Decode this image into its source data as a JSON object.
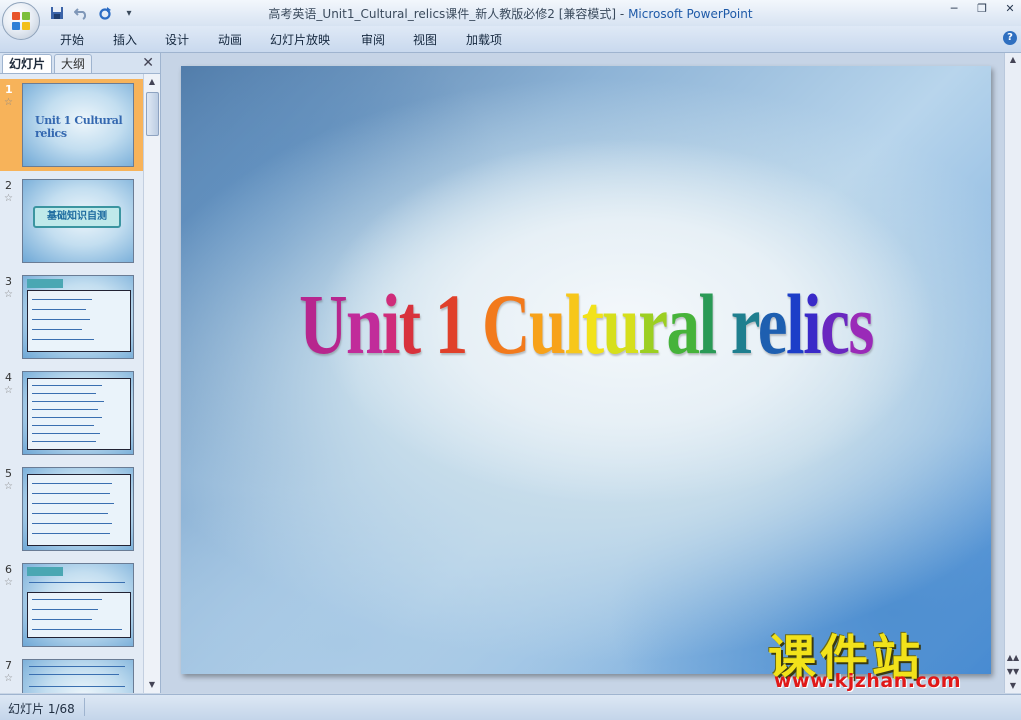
{
  "window": {
    "title_doc": "高考英语_Unit1_Cultural_relics课件_新人教版必修2 [兼容模式]",
    "title_sep": " - ",
    "title_app": "Microsoft PowerPoint"
  },
  "qat": {
    "save_icon": "save-icon",
    "undo_icon": "undo-icon",
    "redo_icon": "redo-icon",
    "more": "▾"
  },
  "ribbon": {
    "tabs": [
      "开始",
      "插入",
      "设计",
      "动画",
      "幻灯片放映",
      "审阅",
      "视图",
      "加载项"
    ],
    "help": "?"
  },
  "pane": {
    "tabs": [
      "幻灯片",
      "大纲"
    ],
    "close": "✕",
    "thumbnails": [
      {
        "num": "1",
        "title": "Unit 1 Cultural relics"
      },
      {
        "num": "2",
        "title": "基础知识自测"
      },
      {
        "num": "3"
      },
      {
        "num": "4"
      },
      {
        "num": "5"
      },
      {
        "num": "6"
      },
      {
        "num": "7"
      }
    ]
  },
  "slide": {
    "title_chars": [
      {
        "c": "U",
        "color": "#b7268e"
      },
      {
        "c": "n",
        "color": "#c12c9a"
      },
      {
        "c": "i",
        "color": "#cf2c7a"
      },
      {
        "c": "t",
        "color": "#d8323c"
      },
      {
        "c": " ",
        "color": "#000000"
      },
      {
        "c": "1",
        "color": "#e0402a"
      },
      {
        "c": " ",
        "color": "#000000"
      },
      {
        "c": "C",
        "color": "#f27a1c"
      },
      {
        "c": "u",
        "color": "#f7a21a"
      },
      {
        "c": "l",
        "color": "#f7c71a"
      },
      {
        "c": "t",
        "color": "#f2e21a"
      },
      {
        "c": "u",
        "color": "#d6df1c"
      },
      {
        "c": "r",
        "color": "#9ccf22"
      },
      {
        "c": "a",
        "color": "#46b33a"
      },
      {
        "c": "l",
        "color": "#2a9a56"
      },
      {
        "c": " ",
        "color": "#000000"
      },
      {
        "c": "r",
        "color": "#1f7f8f"
      },
      {
        "c": "e",
        "color": "#1e5fb0"
      },
      {
        "c": "l",
        "color": "#1c3ec8"
      },
      {
        "c": "i",
        "color": "#3a2ac8"
      },
      {
        "c": "c",
        "color": "#6a28c0"
      },
      {
        "c": "s",
        "color": "#9a2ab8"
      }
    ]
  },
  "watermark": {
    "cn": "课件站",
    "url": "www.kjzhan.com"
  },
  "status": {
    "slide_info": "幻灯片 1/68"
  }
}
